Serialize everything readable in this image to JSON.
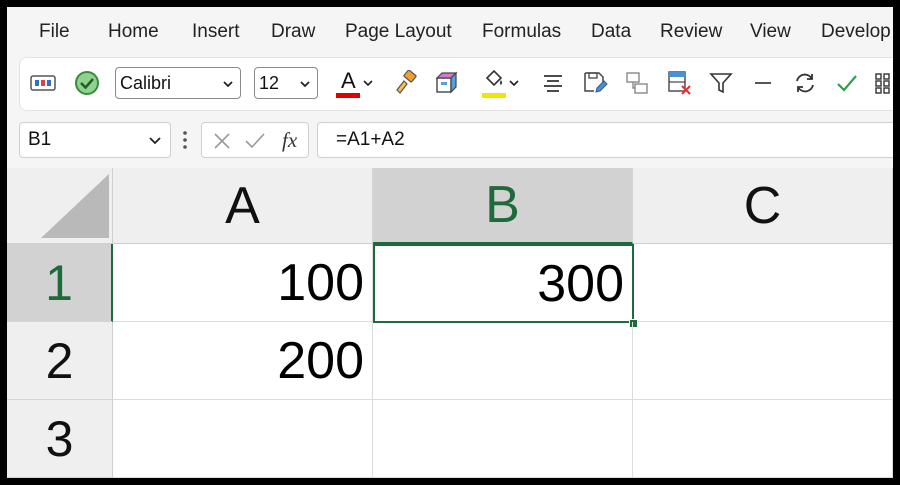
{
  "menu": [
    "File",
    "Home",
    "Insert",
    "Draw",
    "Page Layout",
    "Formulas",
    "Data",
    "Review",
    "View",
    "Develop"
  ],
  "toolbar": {
    "font_name": "Calibri",
    "font_size": "12",
    "font_color_letter": "A",
    "font_color": "#e00000",
    "fill_color": "#f5e400",
    "accept_color": "#2aa14a",
    "icons": [
      "cell-styles-icon",
      "check-circle-icon",
      "font-color-icon",
      "format-painter-icon",
      "3d-box-icon",
      "fill-color-icon",
      "align-icon",
      "save-edit-icon",
      "link-icon",
      "delete-table-icon",
      "filter-icon",
      "minus-icon",
      "refresh-icon",
      "check-icon",
      "grid-icon"
    ]
  },
  "formula_bar": {
    "name_box": "B1",
    "fx_label": "fx",
    "formula": "=A1+A2"
  },
  "sheet": {
    "columns": [
      "A",
      "B",
      "C"
    ],
    "rows": [
      "1",
      "2",
      "3"
    ],
    "selected_cell": "B1",
    "cells": {
      "A1": "100",
      "A2": "200",
      "B1": "300"
    }
  }
}
